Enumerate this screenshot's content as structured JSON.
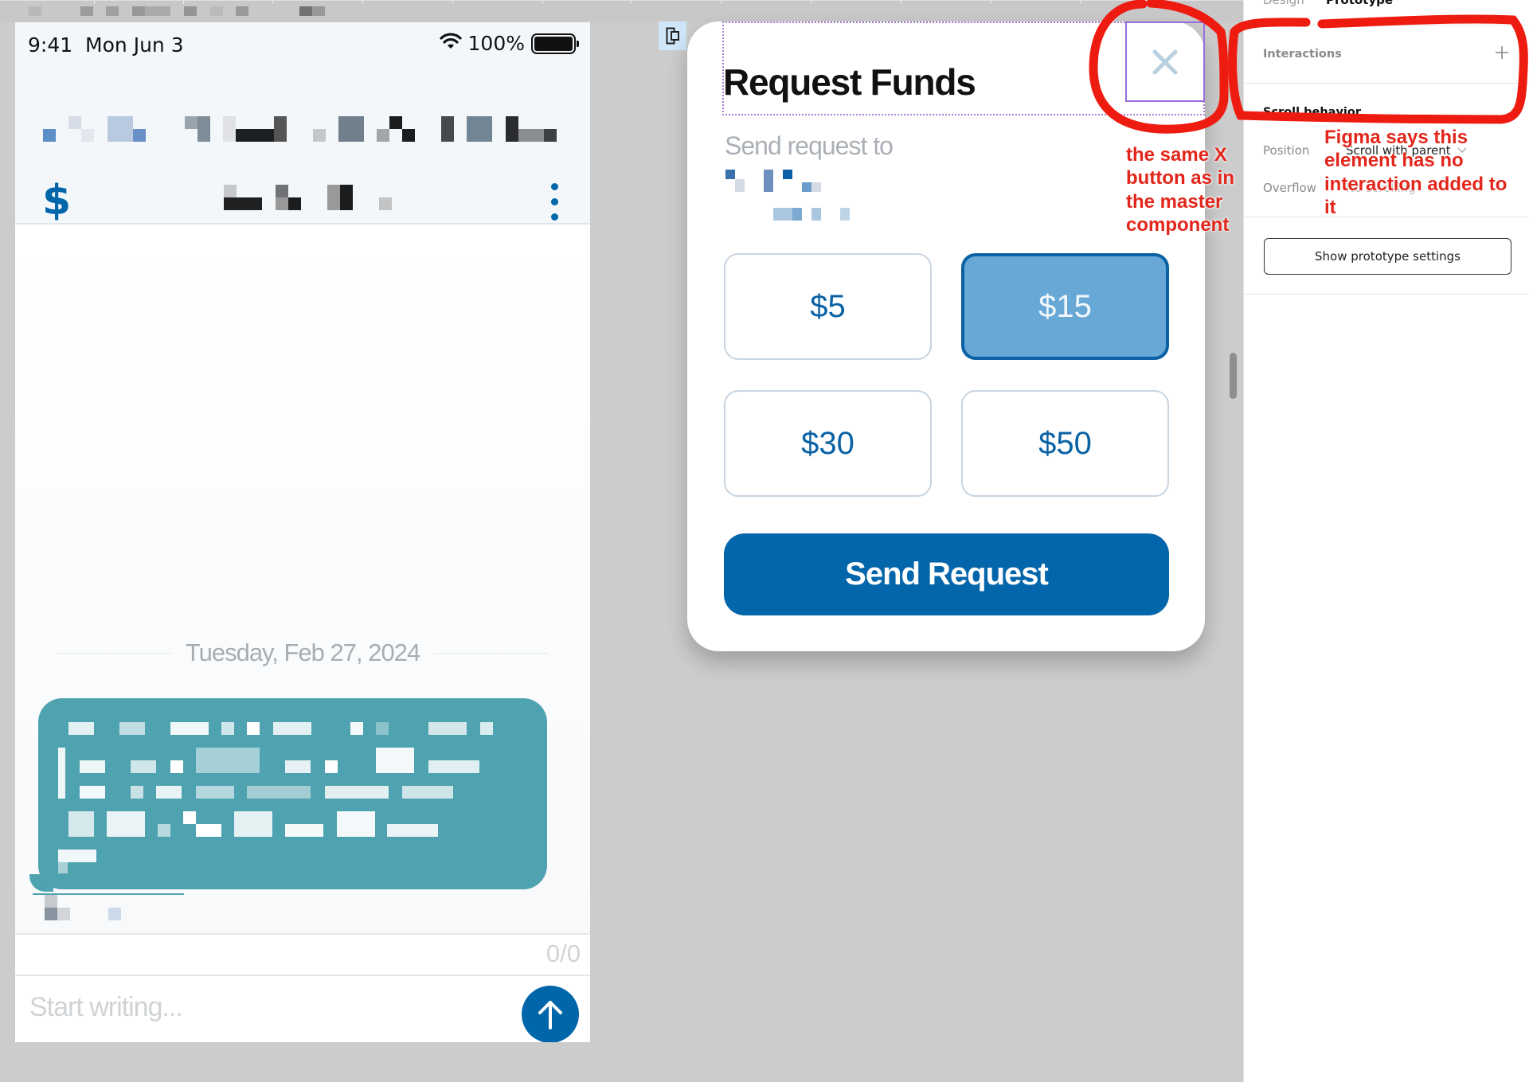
{
  "canvas": {
    "frame_label": "[redacted frame name]"
  },
  "phone": {
    "status_bar": {
      "time": "9:41",
      "date": "Mon Jun 3",
      "wifi_icon": "wifi-icon",
      "battery_percent": "100%",
      "battery_level": 1.0
    },
    "header": {
      "title_redacted": "[redacted]",
      "subtitle_redacted": "[redacted]",
      "left_icon": "dollar-icon",
      "right_icon": "more-vertical-icon"
    },
    "chat": {
      "date_divider": "Tuesday, Feb 27, 2024",
      "messages": [
        {
          "text": "[redacted message]",
          "sender": "[redacted]",
          "color": "#4fa3b0"
        }
      ]
    },
    "counter": "0/0",
    "composer": {
      "placeholder": "Start writing...",
      "value": "",
      "send_icon": "arrow-up-icon"
    }
  },
  "modal": {
    "title": "Request Funds",
    "close_icon": "close-icon",
    "send_to_label": "Send request to",
    "recipient_redacted": "[redacted]",
    "amounts": [
      {
        "label": "$5",
        "selected": false
      },
      {
        "label": "$15",
        "selected": true
      },
      {
        "label": "$30",
        "selected": false
      },
      {
        "label": "$50",
        "selected": false
      }
    ],
    "submit_label": "Send Request",
    "colors": {
      "primary": "#0466aa",
      "selected_fill": "#68a8d6",
      "amount_text": "#0a62a5"
    }
  },
  "annotations": {
    "x_button_note": "the same X button as in the master component",
    "panel_note": "Figma says this element has no interaction added to it",
    "color": "#e3261b"
  },
  "panel": {
    "tabs": [
      {
        "label": "Design",
        "active": false
      },
      {
        "label": "Prototype",
        "active": true
      }
    ],
    "interactions_label": "Interactions",
    "scroll_behavior": {
      "heading": "Scroll behavior",
      "position_label": "Position",
      "position_value": "Scroll with parent",
      "overflow_label": "Overflow",
      "overflow_value": "No scrolling"
    },
    "show_settings_label": "Show prototype settings"
  }
}
